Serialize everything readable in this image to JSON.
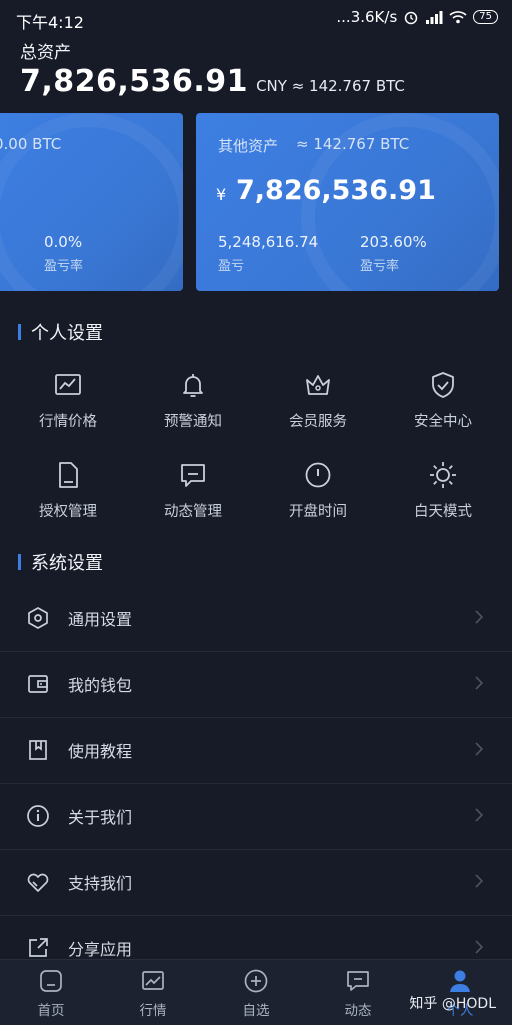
{
  "status_bar": {
    "time": "下午4:12",
    "network_speed": "...3.6K/s",
    "battery": "75"
  },
  "assets": {
    "label": "总资产",
    "amount": "7,826,536.91",
    "sub": "CNY ≈ 142.767 BTC"
  },
  "card_left": {
    "btc": "0.00 BTC",
    "rate_value": "0.0%",
    "rate_label": "盈亏率"
  },
  "card_right": {
    "title": "其他资产",
    "btc": "≈ 142.767 BTC",
    "currency_symbol": "¥",
    "amount": "7,826,536.91",
    "pl_value": "5,248,616.74",
    "pl_label": "盈亏",
    "rate_value": "203.60%",
    "rate_label": "盈亏率"
  },
  "personal_settings": {
    "title": "个人设置",
    "items": [
      {
        "label": "行情价格",
        "icon": "chart-icon"
      },
      {
        "label": "预警通知",
        "icon": "bell-icon"
      },
      {
        "label": "会员服务",
        "icon": "crown-icon"
      },
      {
        "label": "安全中心",
        "icon": "shield-icon"
      },
      {
        "label": "授权管理",
        "icon": "document-icon"
      },
      {
        "label": "动态管理",
        "icon": "message-icon"
      },
      {
        "label": "开盘时间",
        "icon": "clock-icon"
      },
      {
        "label": "白天模式",
        "icon": "sun-icon"
      }
    ]
  },
  "system_settings": {
    "title": "系统设置",
    "items": [
      {
        "label": "通用设置",
        "icon": "hexagon-gear-icon"
      },
      {
        "label": "我的钱包",
        "icon": "wallet-icon"
      },
      {
        "label": "使用教程",
        "icon": "bookmark-icon"
      },
      {
        "label": "关于我们",
        "icon": "info-icon"
      },
      {
        "label": "支持我们",
        "icon": "heart-icon"
      },
      {
        "label": "分享应用",
        "icon": "share-icon"
      }
    ]
  },
  "tab_bar": {
    "tabs": [
      {
        "label": "首页",
        "icon": "home-icon"
      },
      {
        "label": "行情",
        "icon": "chart-icon"
      },
      {
        "label": "自选",
        "icon": "plus-circle-icon"
      },
      {
        "label": "动态",
        "icon": "message-icon"
      },
      {
        "label": "个人",
        "icon": "person-icon",
        "active": true
      }
    ]
  },
  "watermark": "知乎 @HODL",
  "colors": {
    "background": "#161b27",
    "accent": "#3d7ee2",
    "card": "#3a78d6"
  }
}
